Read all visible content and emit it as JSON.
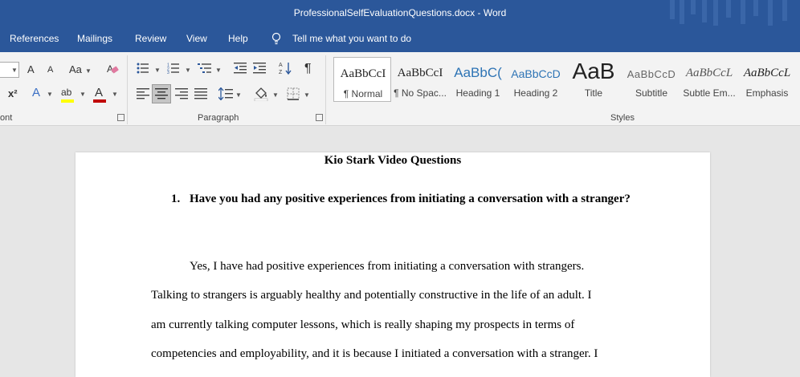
{
  "window": {
    "title": "ProfessionalSelfEvaluationQuestions.docx  -  Word"
  },
  "tabs": [
    "References",
    "Mailings",
    "Review",
    "View",
    "Help"
  ],
  "tell_me": "Tell me what you want to do",
  "ribbon": {
    "groups": {
      "font": "ont",
      "paragraph": "Paragraph",
      "styles": "Styles"
    },
    "font_buttons": {
      "grow": "A",
      "shrink": "A",
      "change_case": "Aa",
      "superscript": "x²",
      "text_effects": "A",
      "highlight": "ab",
      "font_color": "A"
    },
    "styles": [
      {
        "preview": "AaBbCcI",
        "name": "¶ Normal"
      },
      {
        "preview": "AaBbCcI",
        "name": "¶ No Spac..."
      },
      {
        "preview": "AaBbC(",
        "name": "Heading 1"
      },
      {
        "preview": "AaBbCcD",
        "name": "Heading 2"
      },
      {
        "preview": "AaB",
        "name": "Title"
      },
      {
        "preview": "AaBbCcD",
        "name": "Subtitle"
      },
      {
        "preview": "AaBbCcL",
        "name": "Subtle Em..."
      },
      {
        "preview": "AaBbCcL",
        "name": "Emphasis"
      }
    ]
  },
  "colors": {
    "accent": "#2b579a",
    "font_color": "#c00000",
    "highlight": "#ffff00"
  },
  "document": {
    "title": "Kio Stark Video Questions",
    "question_number": "1.",
    "question": "Have you had any positive experiences from initiating a conversation with a stranger?",
    "lines": [
      "Yes, I have had positive experiences from initiating a conversation with strangers.",
      "Talking to strangers is arguably healthy and potentially constructive in the life of an adult. I",
      "am currently talking computer lessons, which is really shaping my prospects in terms of",
      "competencies and employability, and it is because I initiated a conversation with a stranger. I"
    ]
  }
}
